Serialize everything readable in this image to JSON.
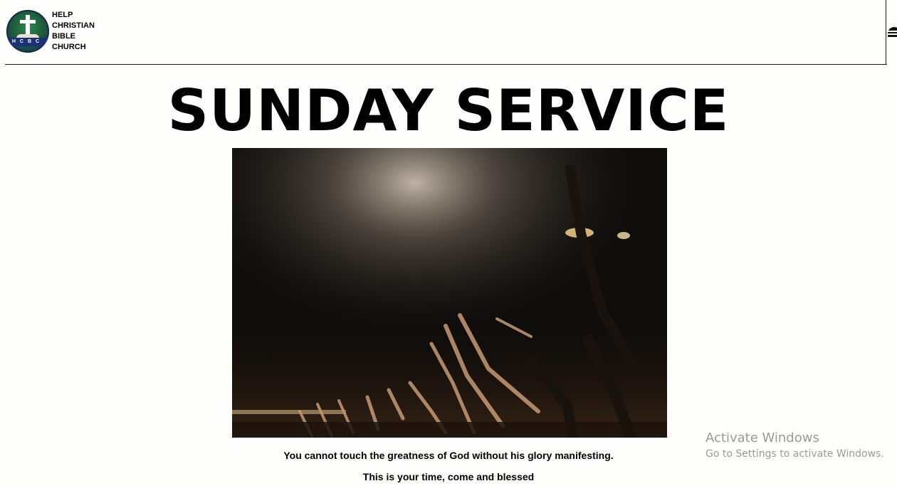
{
  "header": {
    "logo_badge_text": "HCBC",
    "church_name_lines": [
      "HELP",
      "CHRISTIAN",
      "BIBLE",
      "CHURCH"
    ]
  },
  "main": {
    "title": "SUNDAY SERVICE",
    "hero_image": "worship-crowd-raised-hands-photo",
    "line1": "You cannot touch the greatness of God without his glory manifesting.",
    "line2": "This is your time, come and blessed"
  },
  "watermark": {
    "title": "Activate Windows",
    "subtitle": "Go to Settings to activate Windows."
  },
  "icons": {
    "logo": "church-cross-logo-icon",
    "menu": "menu-icon"
  },
  "colors": {
    "background": "#fefefc",
    "text": "#000000",
    "watermark": "#9a9a9a"
  }
}
